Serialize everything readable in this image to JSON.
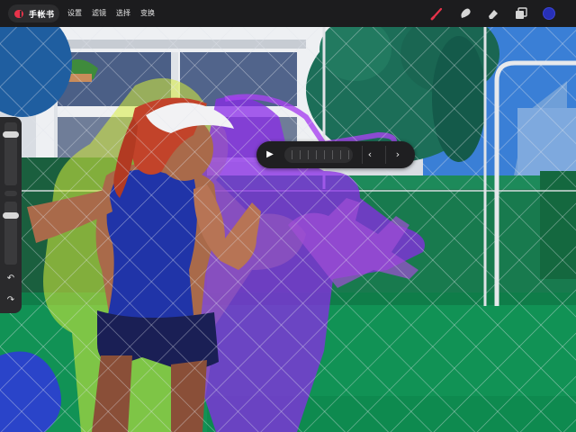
{
  "topbar": {
    "app_title": "手帐书",
    "menu": [
      "设置",
      "滤镜",
      "选择",
      "变换"
    ],
    "tools": [
      "brush-icon",
      "smudge-icon",
      "eraser-icon",
      "layers-icon"
    ],
    "current_color": "#2730b8",
    "accent": "#e8334a"
  },
  "sidebar": {
    "brush_size": 0.84,
    "opacity": 0.81,
    "undo_glyph": "↶",
    "redo_glyph": "↷"
  },
  "animation": {
    "play_glyph": "▶",
    "prev_glyph": "‹",
    "next_glyph": "›"
  }
}
